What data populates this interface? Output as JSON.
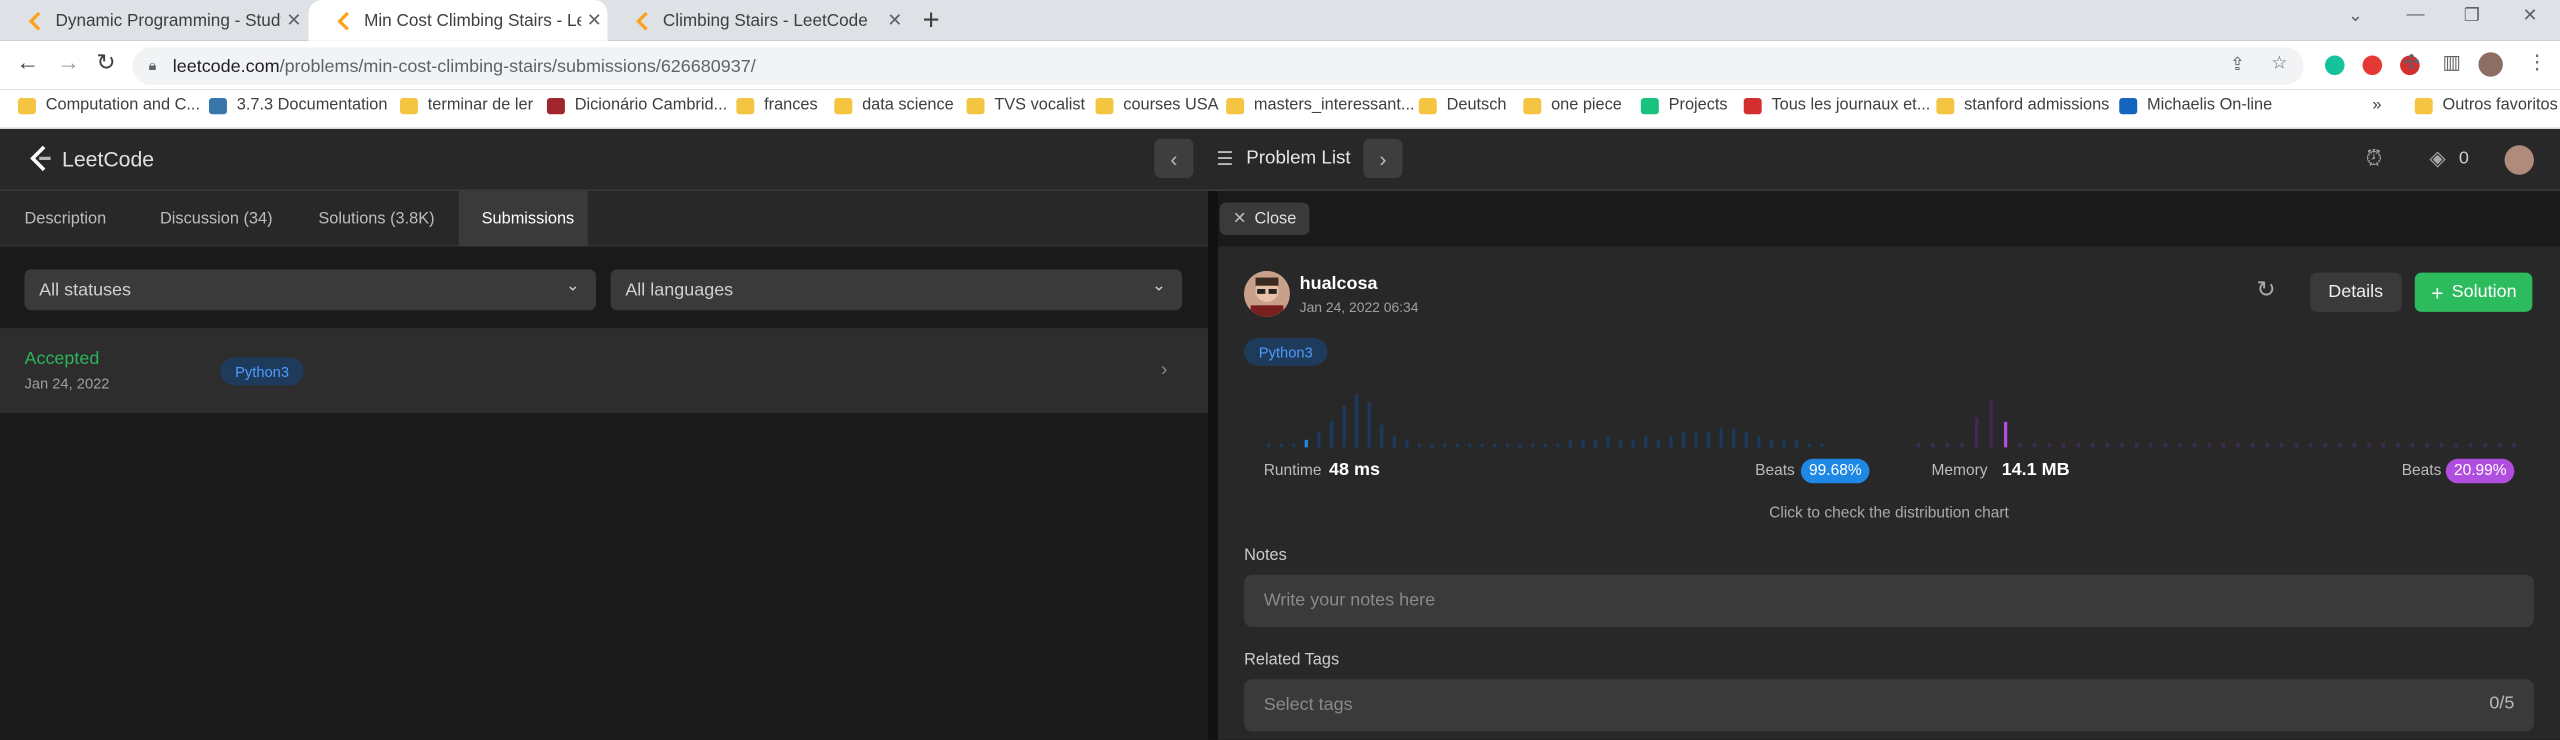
{
  "browser": {
    "tabs": [
      {
        "title": "Dynamic Programming - Study P"
      },
      {
        "title": "Min Cost Climbing Stairs - LeetC"
      },
      {
        "title": "Climbing Stairs - LeetCode"
      }
    ],
    "url_host": "leetcode.com",
    "url_path": "/problems/min-cost-climbing-stairs/submissions/626680937/",
    "bookmarks": [
      "Computation and C...",
      "3.7.3 Documentation",
      "terminar de ler",
      "Dicionário Cambrid...",
      "frances",
      "data science",
      "TVS vocalist",
      "courses USA",
      "masters_interessant...",
      "Deutsch",
      "one piece",
      "Projects",
      "Tous les journaux et...",
      "stanford admissions",
      "Michaelis On-line"
    ],
    "other_bookmarks": "Outros favoritos",
    "bookmarks_more": "»"
  },
  "header": {
    "logo": "LeetCode",
    "problem_list": "Problem List",
    "streak_count": "0"
  },
  "left": {
    "tabs": [
      "Description",
      "Discussion (34)",
      "Solutions (3.8K)",
      "Submissions"
    ],
    "status_filter": "All statuses",
    "language_filter": "All languages",
    "submission": {
      "status": "Accepted",
      "date": "Jan 24, 2022",
      "lang": "Python3"
    }
  },
  "right": {
    "close_label": "Close",
    "username": "hualcosa",
    "submitted_at": "Jan 24, 2022 06:34",
    "details_label": "Details",
    "solution_label": "Solution",
    "lang": "Python3",
    "runtime_label": "Runtime",
    "runtime_value": "48 ms",
    "runtime_beats_label": "Beats",
    "runtime_beats": "99.68%",
    "memory_label": "Memory",
    "memory_value": "14.1 MB",
    "memory_beats_label": "Beats",
    "memory_beats": "20.99%",
    "chart_hint": "Click to check the distribution chart",
    "notes_label": "Notes",
    "notes_placeholder": "Write your notes here",
    "tags_label": "Related Tags",
    "tags_placeholder": "Select tags",
    "tags_count": "0/5"
  },
  "colors": {
    "accent_green": "#2cbb5d",
    "runtime_blue": "#1e88e5",
    "memory_purple": "#b04ee0"
  }
}
